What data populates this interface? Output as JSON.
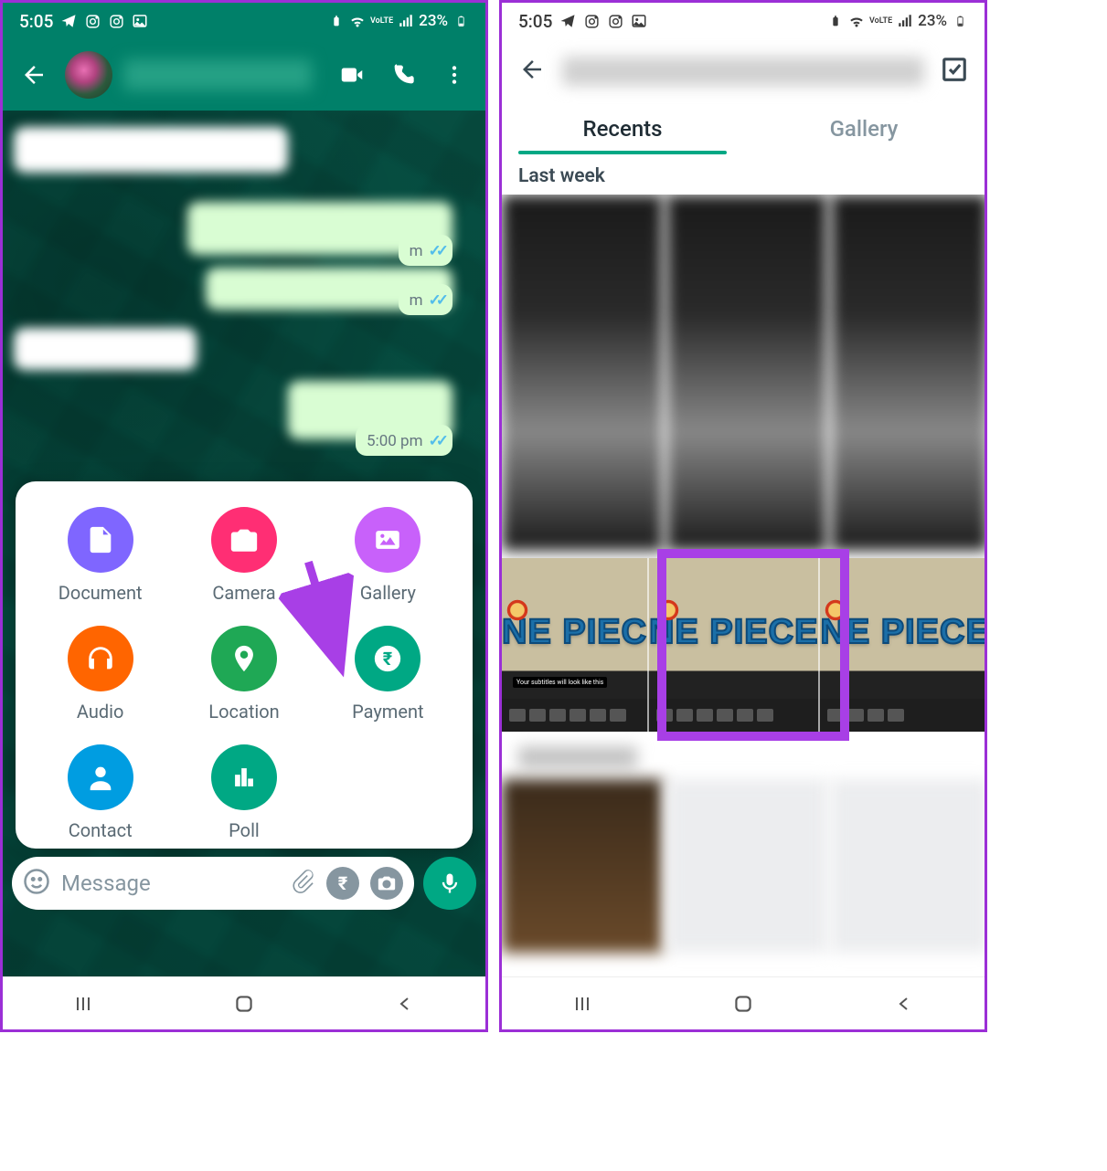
{
  "status": {
    "time": "5:05",
    "battery_pct": "23%",
    "net_label": "VoLTE"
  },
  "chat": {
    "msg_time_1": "m",
    "msg_time_2": "m",
    "msg_time_3": "5:00 pm"
  },
  "attach": {
    "document": "Document",
    "camera": "Camera",
    "gallery": "Gallery",
    "audio": "Audio",
    "location": "Location",
    "payment": "Payment",
    "contact": "Contact",
    "poll": "Poll"
  },
  "input": {
    "placeholder": "Message"
  },
  "picker": {
    "tabs": {
      "recents": "Recents",
      "gallery": "Gallery"
    },
    "section1": "Last week"
  },
  "op": {
    "t1": "NE PIEC",
    "t2": "NE PIECE",
    "t3": "NE PIECE",
    "sub": "Your subtitles will look like this"
  }
}
